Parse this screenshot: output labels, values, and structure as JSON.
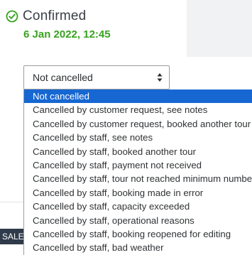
{
  "status": {
    "label": "Confirmed",
    "datetime": "6 Jan 2022, 12:45",
    "icon": "check-circle-icon",
    "accent_color": "#37a21f"
  },
  "cancellation_select": {
    "current_value": "Not cancelled",
    "options": [
      "Not cancelled",
      "Cancelled by customer request, see notes",
      "Cancelled by customer request, booked another tour",
      "Cancelled by staff, see notes",
      "Cancelled by staff, booked another tour",
      "Cancelled by staff, payment not received",
      "Cancelled by staff, tour not reached minimum numbers",
      "Cancelled by staff, booking made in error",
      "Cancelled by staff, capacity exceeded",
      "Cancelled by staff, operational reasons",
      "Cancelled by staff, booking reopened for editing",
      "Cancelled by staff, bad weather"
    ],
    "highlight_color": "#1767d2"
  },
  "badge": {
    "label": "SALE"
  }
}
